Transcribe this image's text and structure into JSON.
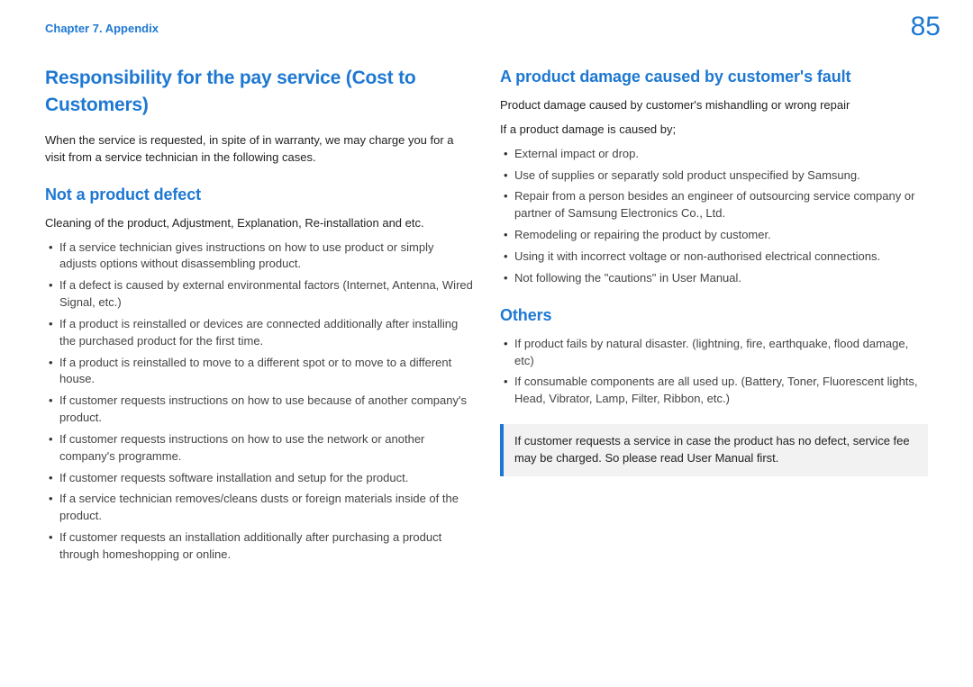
{
  "header": {
    "chapter": "Chapter 7. Appendix",
    "page": "85"
  },
  "left": {
    "main_title": "Responsibility for the pay service (Cost to Customers)",
    "intro": "When the service is requested, in spite of in warranty, we may charge you for a visit from a service technician in the following cases.",
    "sec1": {
      "title": "Not a product defect",
      "lead": "Cleaning of the product, Adjustment, Explanation, Re-installation and etc.",
      "items": [
        "If a service technician gives instructions on how to use product or simply adjusts options without disassembling product.",
        "If a defect is caused by external environmental factors (Internet, Antenna, Wired Signal, etc.)",
        "If a product is reinstalled or devices are connected additionally after installing the purchased product for the first time.",
        "If a product is reinstalled to move to a different spot or to move to a different house.",
        "If customer requests instructions on how to use because of another company's product.",
        "If customer requests instructions on how to use the network or another company's programme.",
        "If customer requests software installation and setup for the product.",
        "If a service technician removes/cleans dusts or foreign materials inside of the product.",
        "If customer requests an installation additionally after purchasing a product through homeshopping or online."
      ]
    }
  },
  "right": {
    "sec2": {
      "title": "A product damage caused by customer's fault",
      "lead1": "Product damage caused by customer's mishandling or wrong repair",
      "lead2": "If a product damage is caused by;",
      "items": [
        "External impact or drop.",
        "Use of supplies or separatly sold product unspecified by Samsung.",
        "Repair from a person besides an engineer of outsourcing service company or partner of Samsung Electronics Co., Ltd.",
        "Remodeling or repairing the product by customer.",
        "Using it with incorrect voltage or non-authorised electrical connections.",
        "Not following the \"cautions\" in User Manual."
      ]
    },
    "sec3": {
      "title": "Others",
      "items": [
        "If product fails by natural disaster. (lightning, fire, earthquake, flood damage, etc)",
        "If consumable components are all used up. (Battery, Toner, Fluorescent lights, Head, Vibrator, Lamp, Filter, Ribbon, etc.)"
      ]
    },
    "note": "If customer requests a service in case the product has no defect, service fee may be charged. So please read User Manual first."
  }
}
